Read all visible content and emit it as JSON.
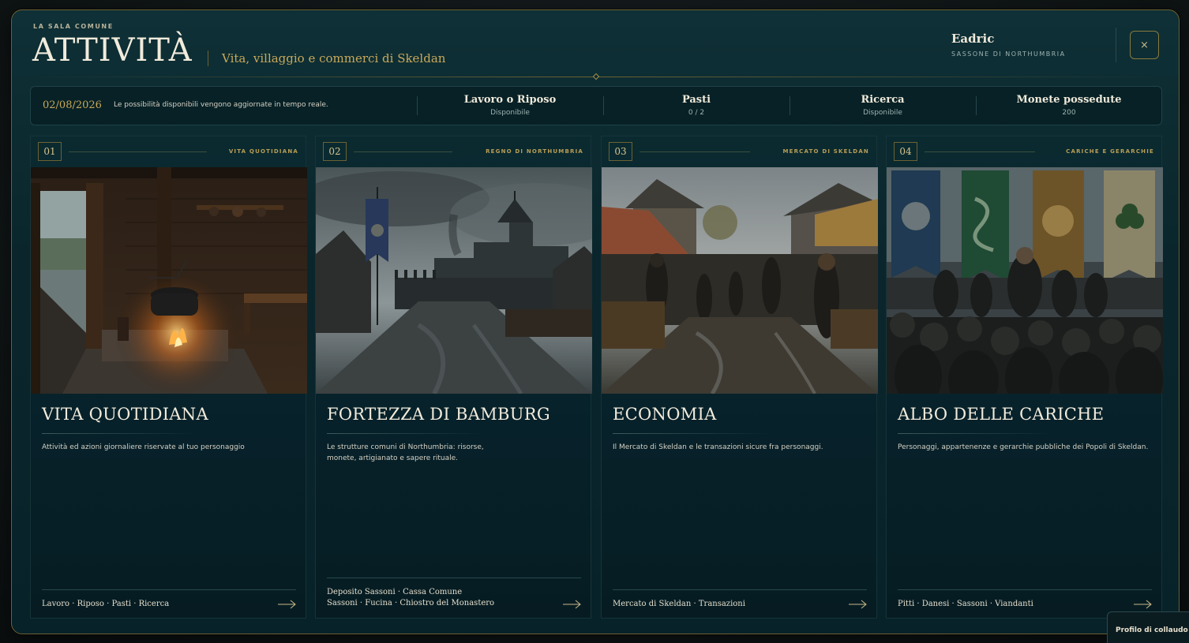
{
  "header": {
    "eyebrow": "LA SALA COMUNE",
    "title": "ATTIVITÀ",
    "subtitle": "Vita, villaggio e commerci di Skeldan",
    "close_label": "×"
  },
  "user": {
    "name": "Eadric",
    "role": "SASSONE DI NORTHUMBRIA"
  },
  "status": {
    "date": "02/08/2026",
    "note": "Le possibilità disponibili vengono aggiornate in tempo reale.",
    "stats": [
      {
        "label": "Lavoro o Riposo",
        "value": "Disponibile"
      },
      {
        "label": "Pasti",
        "value": "0 / 2"
      },
      {
        "label": "Ricerca",
        "value": "Disponibile"
      },
      {
        "label": "Monete possedute",
        "value": "200"
      }
    ]
  },
  "cards": [
    {
      "number": "01",
      "tag": "VITA QUOTIDIANA",
      "title": "VITA QUOTIDIANA",
      "description": "Attività ed azioni giornaliere riservate al tuo personaggio",
      "links": [
        "Lavoro · Riposo · Pasti · Ricerca"
      ],
      "image": "hearth-interior-image"
    },
    {
      "number": "02",
      "tag": "REGNO DI NORTHUMBRIA",
      "title": "FORTEZZA DI BAMBURG",
      "description": "Le strutture comuni di Northumbria: risorse, monete, artigianato e sapere rituale.",
      "links": [
        "Deposito Sassoni · Cassa Comune",
        "Sassoni · Fucina · Chiostro del Monastero"
      ],
      "image": "fortress-image"
    },
    {
      "number": "03",
      "tag": "MERCATO DI SKELDAN",
      "title": "ECONOMIA",
      "description": "Il Mercato di Skeldan e le transazioni sicure fra personaggi.",
      "links": [
        "Mercato di Skeldan · Transazioni"
      ],
      "image": "market-image"
    },
    {
      "number": "04",
      "tag": "CARICHE E GERARCHIE",
      "title": "ALBO DELLE CARICHE",
      "description": "Personaggi, appartenenze e gerarchie pubbliche dei Popoli di Skeldan.",
      "links": [
        "Pitti · Danesi · Sassoni · Viandanti"
      ],
      "image": "banners-assembly-image"
    }
  ],
  "debug": {
    "label": "Profilo di collaudo"
  },
  "colors": {
    "accent_gold": "#c9a85a",
    "panel_bg": "#0a262c",
    "border_gold": "#6d6233"
  }
}
